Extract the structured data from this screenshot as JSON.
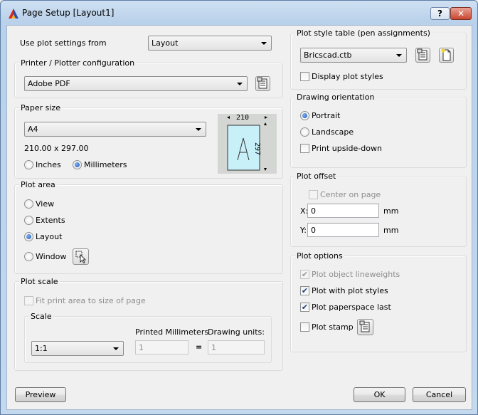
{
  "window": {
    "title": "Page Setup [Layout1]",
    "help_label": "?",
    "close_label": "✕"
  },
  "use_plot_settings": {
    "label": "Use plot settings from",
    "value": "Layout"
  },
  "printer": {
    "group_title": "Printer / Plotter configuration",
    "value": "Adobe PDF"
  },
  "paper": {
    "group_title": "Paper size",
    "value": "A4",
    "dimensions": "210.00 x 297.00",
    "units": {
      "inches": "Inches",
      "millimeters": "Millimeters",
      "selected": "Millimeters"
    },
    "preview": {
      "width_label": "210",
      "height_label": "297",
      "letter": "A"
    }
  },
  "plot_area": {
    "group_title": "Plot area",
    "options": [
      "View",
      "Extents",
      "Layout",
      "Window"
    ],
    "selected": "Layout"
  },
  "plot_scale": {
    "group_title": "Plot scale",
    "fit_label": "Fit print area to size of page",
    "fit_checked": false,
    "scale_group_title": "Scale",
    "scale_value": "1:1",
    "printed_label": "Printed Millimeters",
    "printed_value": "1",
    "equals": "=",
    "drawing_units_label": "Drawing units:",
    "drawing_units_value": "1"
  },
  "plot_style_table": {
    "group_title": "Plot style table (pen assignments)",
    "value": "Bricscad.ctb",
    "display_label": "Display plot styles",
    "display_checked": false
  },
  "orientation": {
    "group_title": "Drawing orientation",
    "portrait": "Portrait",
    "landscape": "Landscape",
    "selected": "Portrait",
    "upside_down_label": "Print upside-down",
    "upside_down_checked": false
  },
  "plot_offset": {
    "group_title": "Plot offset",
    "center_label": "Center on page",
    "center_checked": false,
    "x_label": "X:",
    "x_value": "0",
    "y_label": "Y:",
    "y_value": "0",
    "unit": "mm"
  },
  "plot_options": {
    "group_title": "Plot options",
    "lineweights_label": "Plot object lineweights",
    "lineweights_checked": true,
    "styles_label": "Plot with plot styles",
    "styles_checked": true,
    "paperspace_label": "Plot paperspace last",
    "paperspace_checked": true,
    "stamp_label": "Plot stamp",
    "stamp_checked": false
  },
  "footer": {
    "preview_label": "Preview",
    "ok_label": "OK",
    "cancel_label": "Cancel"
  },
  "colors": {
    "titlebar": "#b9d1ea",
    "dialog_bg": "#f0f0f0",
    "paper_preview": "#c8f0f8",
    "close_button": "#c9462f"
  }
}
